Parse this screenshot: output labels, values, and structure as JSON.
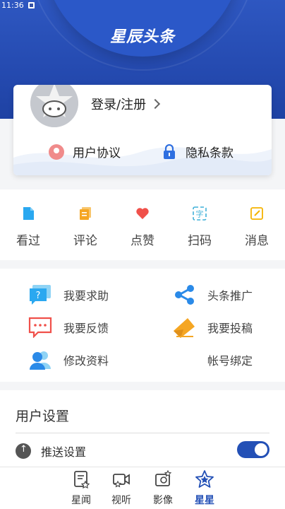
{
  "status_bar": {
    "time": "11:36"
  },
  "header": {
    "brand": "星辰头条"
  },
  "profile": {
    "login_label": "登录/注册",
    "agreement_label": "用户协议",
    "privacy_label": "隐私条款"
  },
  "shortcuts": [
    {
      "label": "看过",
      "icon": "viewed-icon",
      "color": "#2aa8f0"
    },
    {
      "label": "评论",
      "icon": "comment-icon",
      "color": "#f5a623"
    },
    {
      "label": "点赞",
      "icon": "heart-icon",
      "color": "#f0504a"
    },
    {
      "label": "扫码",
      "icon": "scan-icon",
      "color": "#3fb0d8"
    },
    {
      "label": "消息",
      "icon": "message-icon",
      "color": "#f5b300"
    }
  ],
  "services": {
    "help": "我要求助",
    "share": "头条推广",
    "feedback": "我要反馈",
    "submit": "我要投稿",
    "edit_profile": "修改资料",
    "bind_account": "帐号绑定"
  },
  "settings": {
    "title": "用户设置",
    "push_label": "推送设置",
    "push_enabled": true
  },
  "tabbar": {
    "tabs": [
      {
        "label": "星闻",
        "icon": "news-icon",
        "active": false
      },
      {
        "label": "视听",
        "icon": "video-icon",
        "active": false
      },
      {
        "label": "影像",
        "icon": "image-icon",
        "active": false
      },
      {
        "label": "星星",
        "icon": "star-icon",
        "active": true
      }
    ]
  },
  "colors": {
    "primary": "#2350b6",
    "header": "#2e57c1"
  }
}
